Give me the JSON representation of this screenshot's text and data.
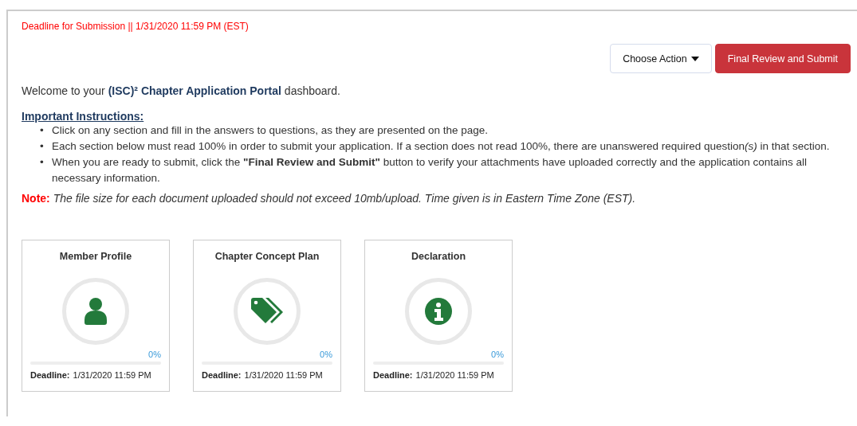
{
  "deadline_banner": "Deadline for Submission || 1/31/2020 11:59 PM (EST)",
  "actions": [
    {
      "kind": "dropdown",
      "label": "Choose Action"
    },
    {
      "kind": "primary",
      "label": "Final Review and Submit"
    }
  ],
  "welcome": "Welcome to your **(ISC)² Chapter Application Portal** dashboard.",
  "instructions": {
    "heading": "Important Instructions:",
    "items": [
      {
        "marker": "•",
        "text": "Click on any section and fill in the answers to questions, as they are presented on the page."
      },
      {
        "marker": "•",
        "text": "Each section below must read 100% in order to submit your application. If a section does not read 100%, there are unanswered required question",
        "emphasis": "(s)",
        "text_after": " in that section."
      },
      {
        "marker": "•",
        "text": "When you are ready to submit, click the ",
        "strong": "\"Final Review and Submit\"",
        "text_after": " button to verify your attachments have uploaded correctly and the application contains all necessary information."
      }
    ]
  },
  "note": {
    "label": "Note:",
    "text": "The file size for each document uploaded should not exceed 10mb/upload. Time given is in Eastern Time Zone (EST)."
  },
  "sections": [
    {
      "title": "Member Profile",
      "kind": "person",
      "percent": "0%",
      "level": 0,
      "deadline_label": "Deadline:",
      "deadline": "1/31/2020 11:59 PM"
    },
    {
      "title": "Chapter Concept Plan",
      "kind": "tags",
      "percent": "0%",
      "level": 0,
      "deadline_label": "Deadline:",
      "deadline": "1/31/2020 11:59 PM"
    },
    {
      "title": "Declaration",
      "kind": "info",
      "percent": "0%",
      "level": 0,
      "deadline_label": "Deadline:",
      "deadline": "1/31/2020 11:59 PM"
    }
  ]
}
